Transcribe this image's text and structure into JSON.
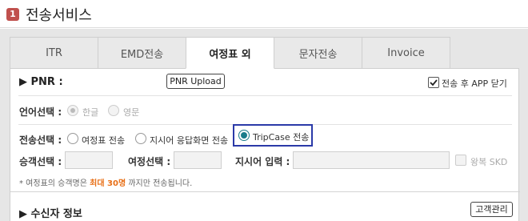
{
  "header": {
    "badge": "1",
    "title": "전송서비스"
  },
  "tabs": [
    {
      "label": "ITR",
      "active": false
    },
    {
      "label": "EMD전송",
      "active": false
    },
    {
      "label": "여정표 외",
      "active": true
    },
    {
      "label": "문자전송",
      "active": false
    },
    {
      "label": "Invoice",
      "active": false
    }
  ],
  "pnr": {
    "title": "▶ PNR :",
    "upload_button": "PNR Upload",
    "close_after_send_label": "전송 후 APP 닫기",
    "close_after_send_checked": true
  },
  "language": {
    "label": "언어선택 :",
    "options": [
      {
        "label": "한글",
        "checked": true,
        "disabled": true
      },
      {
        "label": "영문",
        "checked": false,
        "disabled": true
      }
    ]
  },
  "send_type": {
    "label": "전송선택 :",
    "options": [
      {
        "label": "여정표 전송",
        "checked": false
      },
      {
        "label": "지시어 응답화면 전송",
        "checked": false
      },
      {
        "label": "TripCase 전송",
        "checked": true
      }
    ]
  },
  "fields": {
    "passenger_label": "승객선택 :",
    "itinerary_label": "여정선택 :",
    "command_label": "지시어 입력 :",
    "repeat_skd_label": "왕복 SKD"
  },
  "notice": {
    "prefix": "* 여정표의 승객명은 ",
    "highlight": "최대 30명",
    "suffix": " 까지만 전송됩니다."
  },
  "recipient": {
    "title": "▶ 수신자 정보",
    "customer_button": "고객관리"
  },
  "colors": {
    "badge": "#c0504d",
    "accent": "#1a7c8a",
    "highlight_border": "#2b3aa8",
    "notice_highlight": "#e8711a"
  }
}
